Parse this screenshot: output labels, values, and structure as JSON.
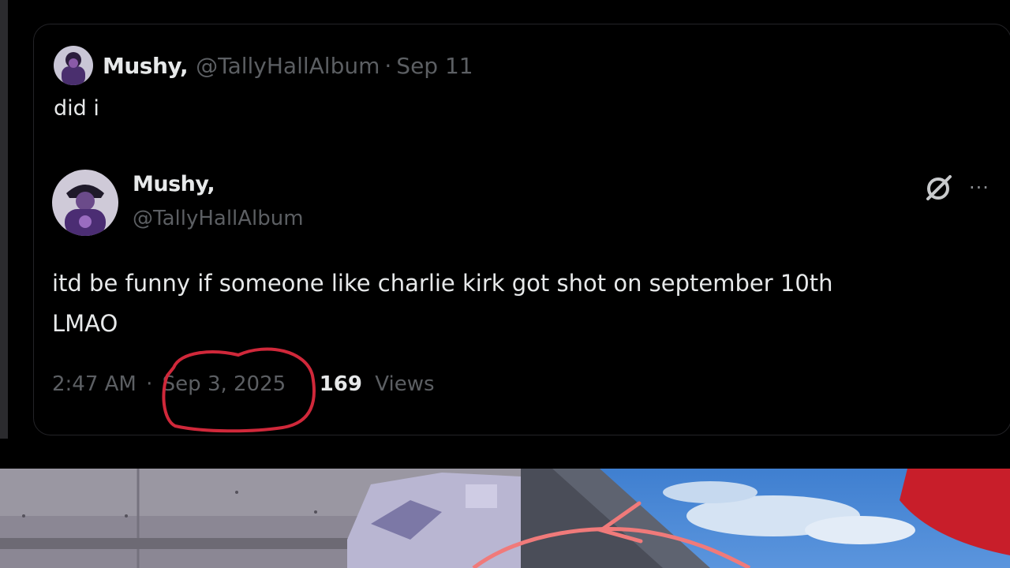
{
  "quoted_tweet": {
    "display_name": "Mushy,",
    "handle": "@TallyHallAlbum",
    "separator": "·",
    "date": "Sep 11",
    "text": "did i"
  },
  "main_tweet": {
    "display_name": "Mushy,",
    "handle": "@TallyHallAlbum",
    "text_line1": "itd be funny if someone like charlie kirk got shot on september 10th",
    "text_line2": "LMAO",
    "time": "2:47 AM",
    "separator": "·",
    "date": "Sep 3, 2025",
    "views_count": "169",
    "views_label": "Views",
    "more_icon_glyph": "···"
  },
  "icons": {
    "grok": "grok-icon",
    "more": "more-icon"
  },
  "colors": {
    "background": "#000000",
    "primary_text": "#e7e9ea",
    "secondary_text": "#5c5f63",
    "annotation_red": "#d0283a",
    "annotation_arrow": "#f07a7a"
  }
}
